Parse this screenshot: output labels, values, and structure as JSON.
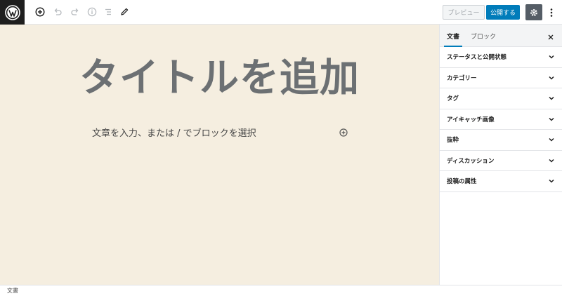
{
  "toolbar": {
    "logo_icon": "wordpress-icon",
    "tools": [
      "add-block-icon",
      "undo-icon",
      "redo-icon",
      "info-icon",
      "list-view-icon",
      "edit-icon"
    ],
    "preview_label": "プレビュー",
    "publish_label": "公開する",
    "settings_icon": "gear-icon",
    "more_icon": "more-vertical-icon"
  },
  "editor": {
    "title_placeholder": "タイトルを追加",
    "paragraph_placeholder": "文章を入力、または / でブロックを選択"
  },
  "sidebar": {
    "tabs": [
      {
        "label": "文書",
        "active": true
      },
      {
        "label": "ブロック",
        "active": false
      }
    ],
    "panels": [
      {
        "label": "ステータスと公開状態"
      },
      {
        "label": "カテゴリー"
      },
      {
        "label": "タグ"
      },
      {
        "label": "アイキャッチ画像"
      },
      {
        "label": "抜粋"
      },
      {
        "label": "ディスカッション"
      },
      {
        "label": "投稿の属性"
      }
    ]
  },
  "footer": {
    "breadcrumb": "文書"
  },
  "colors": {
    "accent": "#007cba",
    "canvas": "#f5eee0",
    "dark": "#1e1e1e"
  }
}
